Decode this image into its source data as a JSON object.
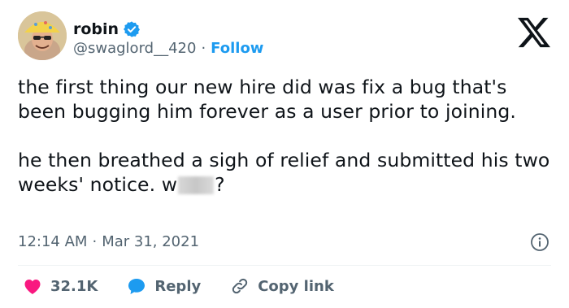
{
  "author": {
    "display_name": "robin",
    "handle": "@swaglord__420",
    "follow_label": "Follow"
  },
  "tweet": {
    "text": "the first thing our new hire did was fix a bug that's been bugging him forever as a user prior to joining.\n\nhe then breathed a sigh of relief and submitted his two weeks' notice. w",
    "text_tail": "?",
    "time": "12:14 AM",
    "date": "Mar 31, 2021"
  },
  "actions": {
    "likes": "32.1K",
    "reply_label": "Reply",
    "copy_link_label": "Copy link"
  },
  "colors": {
    "accent": "#1d9bf0",
    "like": "#f91880",
    "text": "#0f1419",
    "secondary": "#536471"
  },
  "icons": [
    "verified-badge-icon",
    "x-logo-icon",
    "info-icon",
    "heart-icon",
    "reply-bubble-icon",
    "link-icon"
  ]
}
